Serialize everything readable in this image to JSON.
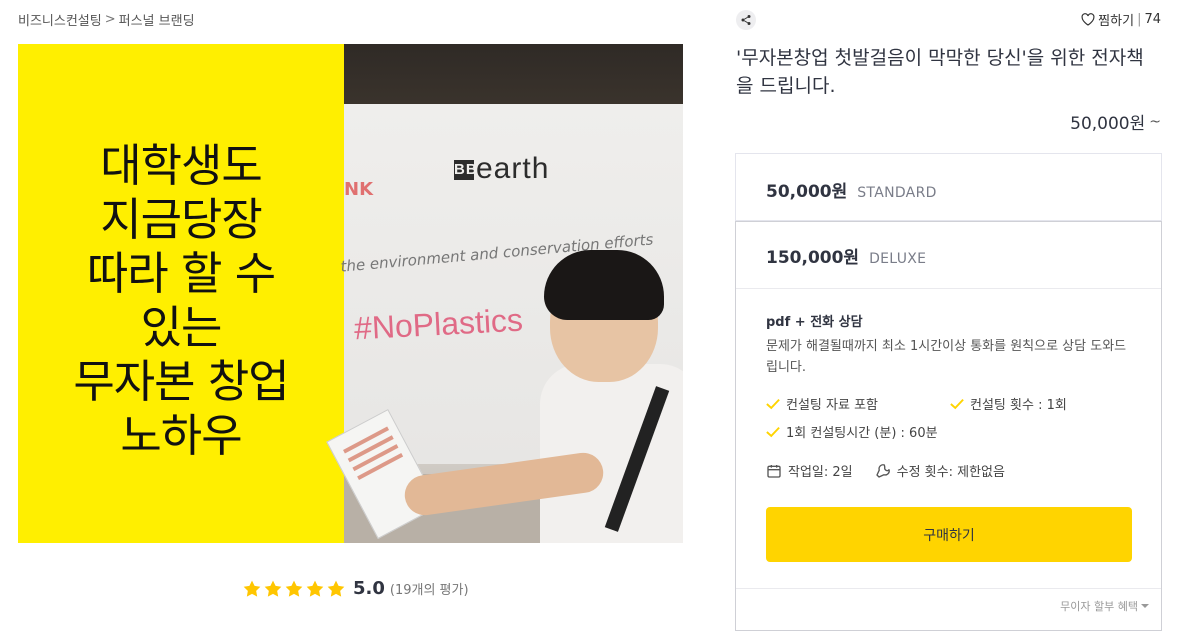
{
  "breadcrumb": {
    "category": "비즈니스컨설팅",
    "separator": ">",
    "subcategory": "퍼스널 브랜딩"
  },
  "hero": {
    "overlay_lines": [
      "대학생도",
      "지금당장",
      "따라 할 수",
      "있는",
      "무자본 창업",
      "노하우"
    ],
    "photo_texts": {
      "bbc": "BBC",
      "earth": "earth",
      "env": "the environment and conservation efforts",
      "tag": "#NoPlastics",
      "ank": "NK"
    },
    "overlay_color": "#ffef00"
  },
  "rating": {
    "score": "5.0",
    "count": "(19개의 평가)",
    "stars": 5,
    "star_color": "#ffc600"
  },
  "header": {
    "like_label": "찜하기",
    "like_divider": "|",
    "like_count": "74",
    "share_icon": "share-icon",
    "heart_icon": "heart-icon"
  },
  "title": "'무자본창업 첫발걸음이 막막한 당신'을 위한 전자책을 드립니다.",
  "price_from": {
    "value": "50,000원",
    "suffix": "~"
  },
  "packages": {
    "standard": {
      "price": "50,000원",
      "name": "STANDARD"
    },
    "deluxe": {
      "price": "150,000원",
      "name": "DELUXE",
      "subtitle": "pdf + 전화 상담",
      "description": "문제가 해결될때까지 최소 1시간이상 통화를 원칙으로 상담 도와드립니다.",
      "features": [
        "컨설팅 자료 포함",
        "컨설팅 횟수 : 1회",
        "1회 컨설팅시간 (분) : 60분"
      ],
      "work_days": "작업일: 2일",
      "revisions": "수정 횟수: 제한없음",
      "buy_label": "구매하기",
      "installment": "무이자 할부 혜택"
    }
  },
  "colors": {
    "accent": "#ffd400",
    "check": "#ffd400",
    "text": "#303441"
  }
}
